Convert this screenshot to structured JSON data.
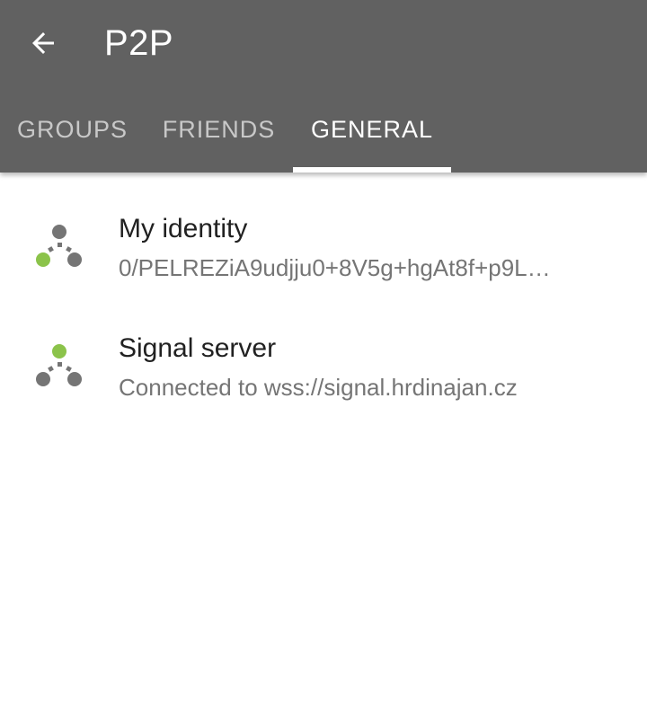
{
  "appbar": {
    "title": "P2P",
    "back_icon": "arrow-back-icon",
    "background": "#616161"
  },
  "tabs": [
    {
      "label": "GROUPS",
      "active": false
    },
    {
      "label": "FRIENDS",
      "active": false
    },
    {
      "label": "GENERAL",
      "active": true
    }
  ],
  "items": [
    {
      "title": "My identity",
      "subtitle": "0/PELREZiA9udjju0+8V5g+hgAt8f+p9L…",
      "icon": "network-identity-icon"
    },
    {
      "title": "Signal server",
      "subtitle": "Connected to wss://signal.hrdinajan.cz",
      "icon": "network-server-icon"
    }
  ],
  "colors": {
    "accent_green": "#8bc34a",
    "node_gray": "#757575"
  }
}
